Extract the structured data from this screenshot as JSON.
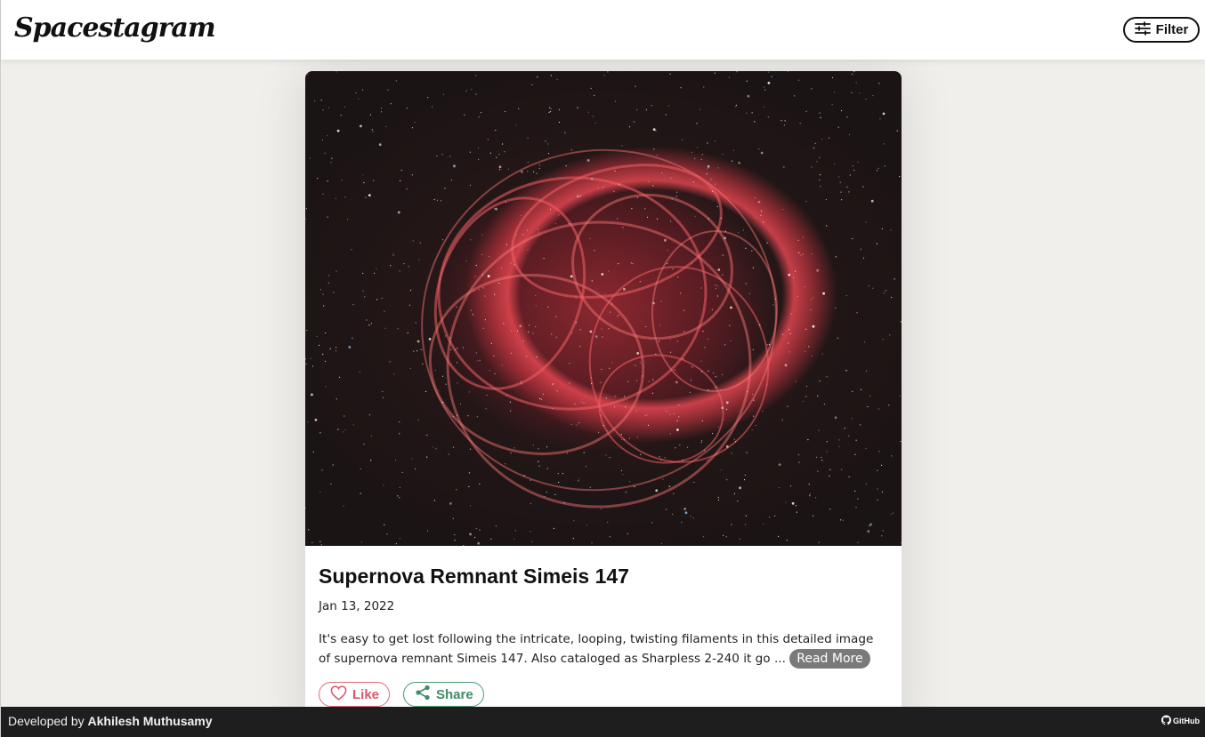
{
  "header": {
    "brand": "Spacestagram",
    "filter_label": "Filter",
    "filter_icon": "sliders-icon"
  },
  "post": {
    "image_icon": "supernova-remnant-photo",
    "title": "Supernova Remnant Simeis 147",
    "date": "Jan 13, 2022",
    "description": "It's easy to get lost following the intricate, looping, twisting filaments in this detailed image of supernova remnant Simeis 147. Also cataloged as Sharpless 2-240 it go ...",
    "read_more_label": "Read More",
    "like_label": "Like",
    "like_icon": "heart-icon",
    "share_label": "Share",
    "share_icon": "share-icon"
  },
  "footer": {
    "developed_by": "Developed by",
    "author": "Akhilesh Muthusamy",
    "github_label": "GitHub",
    "github_icon": "github-icon"
  },
  "colors": {
    "like": "#d9566a",
    "share": "#3f8c66",
    "footer_bg": "#1e1e1e",
    "page_bg": "#f0efeb"
  }
}
